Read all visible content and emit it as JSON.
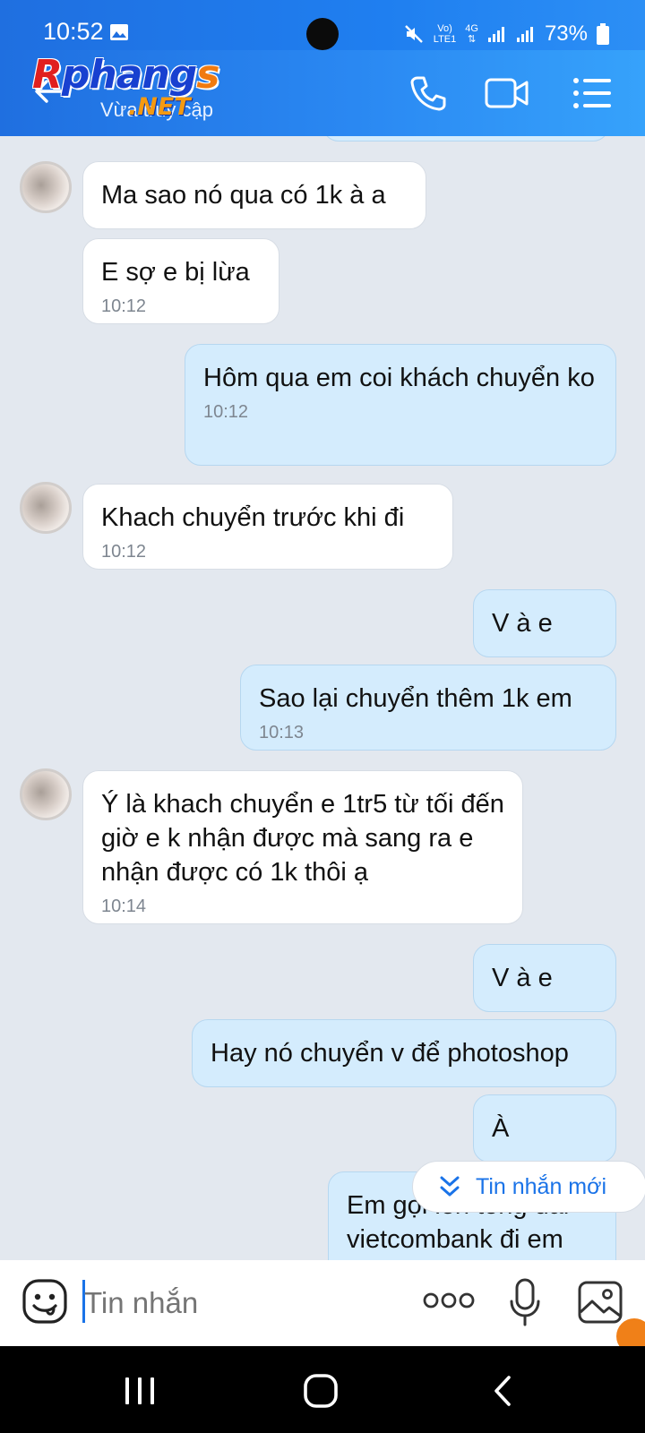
{
  "status_bar": {
    "time": "10:52",
    "net_top": "Vo)",
    "net_bottom": "LTE1",
    "net_type": "4G",
    "battery": "73%"
  },
  "header": {
    "logo_text_r": "R",
    "logo_text_mid": "phang",
    "logo_text_s": "s",
    "logo_net": ".NET",
    "status": "Vừa truy cập"
  },
  "messages": [
    {
      "side": "in",
      "text": "Ma sao nó qua có 1k à a",
      "time": ""
    },
    {
      "side": "in",
      "text": "E sợ e bị lừa",
      "time": "10:12"
    },
    {
      "side": "out",
      "text": "Hôm qua em coi khách chuyển ko",
      "time": "10:12"
    },
    {
      "side": "in",
      "text": "Khach chuyển trước khi đi",
      "time": "10:12"
    },
    {
      "side": "out",
      "text": "V à e",
      "time": ""
    },
    {
      "side": "out",
      "text": "Sao lại chuyển thêm 1k em",
      "time": "10:13"
    },
    {
      "side": "in",
      "text": "Ý là khach chuyển e 1tr5 từ tối đến giờ e k nhận được mà sang ra e nhận được có 1k thôi ạ",
      "time": "10:14"
    },
    {
      "side": "out",
      "text": "V à e",
      "time": ""
    },
    {
      "side": "out",
      "text": "Hay nó chuyển v để photoshop",
      "time": ""
    },
    {
      "side": "out",
      "text": "À",
      "time": ""
    },
    {
      "side": "out",
      "text": "Em gọi lên tổng đài vietcombank đi em",
      "time": ""
    }
  ],
  "new_messages_label": "Tin nhắn mới",
  "input": {
    "placeholder": "Tin nhắn"
  }
}
